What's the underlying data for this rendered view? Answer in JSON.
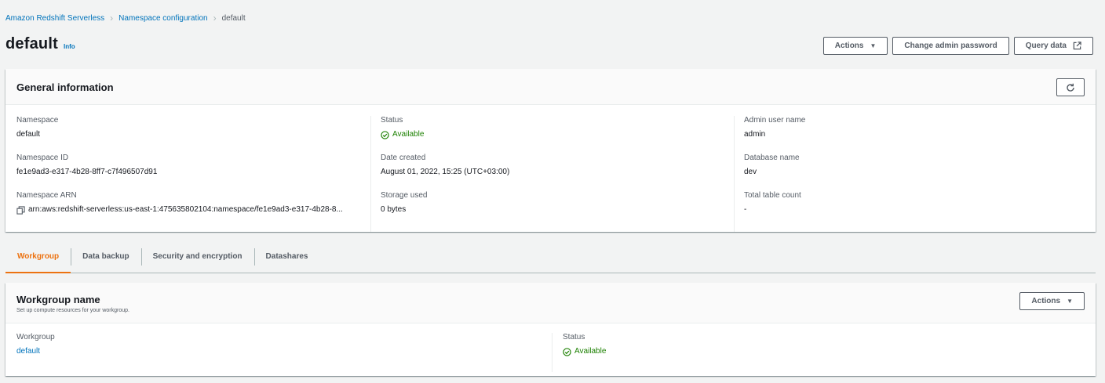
{
  "breadcrumb": {
    "items": [
      "Amazon Redshift Serverless",
      "Namespace configuration"
    ],
    "current": "default"
  },
  "header": {
    "title": "default",
    "info": "Info",
    "actions_label": "Actions",
    "change_password_label": "Change admin password",
    "query_data_label": "Query data"
  },
  "general": {
    "title": "General information",
    "namespace_label": "Namespace",
    "namespace_value": "default",
    "namespace_id_label": "Namespace ID",
    "namespace_id_value": "fe1e9ad3-e317-4b28-8ff7-c7f496507d91",
    "namespace_arn_label": "Namespace ARN",
    "namespace_arn_value": "arn:aws:redshift-serverless:us-east-1:475635802104:namespace/fe1e9ad3-e317-4b28-8...",
    "status_label": "Status",
    "status_value": "Available",
    "date_created_label": "Date created",
    "date_created_value": "August 01, 2022, 15:25 (UTC+03:00)",
    "storage_used_label": "Storage used",
    "storage_used_value": "0 bytes",
    "admin_user_label": "Admin user name",
    "admin_user_value": "admin",
    "database_name_label": "Database name",
    "database_name_value": "dev",
    "table_count_label": "Total table count",
    "table_count_value": "-"
  },
  "tabs": [
    {
      "label": "Workgroup",
      "active": true
    },
    {
      "label": "Data backup",
      "active": false
    },
    {
      "label": "Security and encryption",
      "active": false
    },
    {
      "label": "Datashares",
      "active": false
    }
  ],
  "workgroup": {
    "title": "Workgroup name",
    "description": "Set up compute resources for your workgroup.",
    "actions_label": "Actions",
    "workgroup_label": "Workgroup",
    "workgroup_value": "default",
    "status_label": "Status",
    "status_value": "Available"
  },
  "colors": {
    "link": "#0073bb",
    "success": "#1d8102",
    "active_tab": "#ec7211",
    "background": "#f2f3f3"
  }
}
